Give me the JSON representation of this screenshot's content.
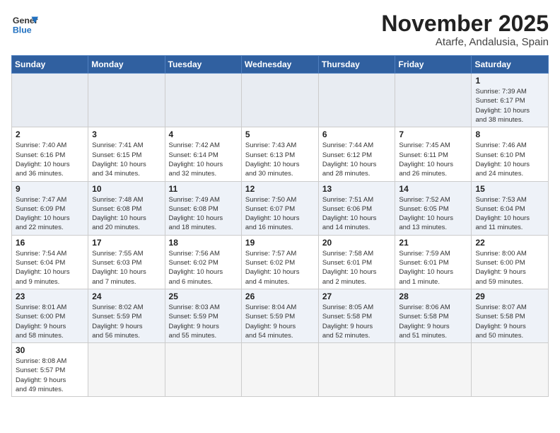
{
  "header": {
    "logo_general": "General",
    "logo_blue": "Blue",
    "month_year": "November 2025",
    "location": "Atarfe, Andalusia, Spain"
  },
  "weekdays": [
    "Sunday",
    "Monday",
    "Tuesday",
    "Wednesday",
    "Thursday",
    "Friday",
    "Saturday"
  ],
  "weeks": [
    [
      {
        "day": "",
        "info": ""
      },
      {
        "day": "",
        "info": ""
      },
      {
        "day": "",
        "info": ""
      },
      {
        "day": "",
        "info": ""
      },
      {
        "day": "",
        "info": ""
      },
      {
        "day": "",
        "info": ""
      },
      {
        "day": "1",
        "info": "Sunrise: 7:39 AM\nSunset: 6:17 PM\nDaylight: 10 hours\nand 38 minutes."
      }
    ],
    [
      {
        "day": "2",
        "info": "Sunrise: 7:40 AM\nSunset: 6:16 PM\nDaylight: 10 hours\nand 36 minutes."
      },
      {
        "day": "3",
        "info": "Sunrise: 7:41 AM\nSunset: 6:15 PM\nDaylight: 10 hours\nand 34 minutes."
      },
      {
        "day": "4",
        "info": "Sunrise: 7:42 AM\nSunset: 6:14 PM\nDaylight: 10 hours\nand 32 minutes."
      },
      {
        "day": "5",
        "info": "Sunrise: 7:43 AM\nSunset: 6:13 PM\nDaylight: 10 hours\nand 30 minutes."
      },
      {
        "day": "6",
        "info": "Sunrise: 7:44 AM\nSunset: 6:12 PM\nDaylight: 10 hours\nand 28 minutes."
      },
      {
        "day": "7",
        "info": "Sunrise: 7:45 AM\nSunset: 6:11 PM\nDaylight: 10 hours\nand 26 minutes."
      },
      {
        "day": "8",
        "info": "Sunrise: 7:46 AM\nSunset: 6:10 PM\nDaylight: 10 hours\nand 24 minutes."
      }
    ],
    [
      {
        "day": "9",
        "info": "Sunrise: 7:47 AM\nSunset: 6:09 PM\nDaylight: 10 hours\nand 22 minutes."
      },
      {
        "day": "10",
        "info": "Sunrise: 7:48 AM\nSunset: 6:08 PM\nDaylight: 10 hours\nand 20 minutes."
      },
      {
        "day": "11",
        "info": "Sunrise: 7:49 AM\nSunset: 6:08 PM\nDaylight: 10 hours\nand 18 minutes."
      },
      {
        "day": "12",
        "info": "Sunrise: 7:50 AM\nSunset: 6:07 PM\nDaylight: 10 hours\nand 16 minutes."
      },
      {
        "day": "13",
        "info": "Sunrise: 7:51 AM\nSunset: 6:06 PM\nDaylight: 10 hours\nand 14 minutes."
      },
      {
        "day": "14",
        "info": "Sunrise: 7:52 AM\nSunset: 6:05 PM\nDaylight: 10 hours\nand 13 minutes."
      },
      {
        "day": "15",
        "info": "Sunrise: 7:53 AM\nSunset: 6:04 PM\nDaylight: 10 hours\nand 11 minutes."
      }
    ],
    [
      {
        "day": "16",
        "info": "Sunrise: 7:54 AM\nSunset: 6:04 PM\nDaylight: 10 hours\nand 9 minutes."
      },
      {
        "day": "17",
        "info": "Sunrise: 7:55 AM\nSunset: 6:03 PM\nDaylight: 10 hours\nand 7 minutes."
      },
      {
        "day": "18",
        "info": "Sunrise: 7:56 AM\nSunset: 6:02 PM\nDaylight: 10 hours\nand 6 minutes."
      },
      {
        "day": "19",
        "info": "Sunrise: 7:57 AM\nSunset: 6:02 PM\nDaylight: 10 hours\nand 4 minutes."
      },
      {
        "day": "20",
        "info": "Sunrise: 7:58 AM\nSunset: 6:01 PM\nDaylight: 10 hours\nand 2 minutes."
      },
      {
        "day": "21",
        "info": "Sunrise: 7:59 AM\nSunset: 6:01 PM\nDaylight: 10 hours\nand 1 minute."
      },
      {
        "day": "22",
        "info": "Sunrise: 8:00 AM\nSunset: 6:00 PM\nDaylight: 9 hours\nand 59 minutes."
      }
    ],
    [
      {
        "day": "23",
        "info": "Sunrise: 8:01 AM\nSunset: 6:00 PM\nDaylight: 9 hours\nand 58 minutes."
      },
      {
        "day": "24",
        "info": "Sunrise: 8:02 AM\nSunset: 5:59 PM\nDaylight: 9 hours\nand 56 minutes."
      },
      {
        "day": "25",
        "info": "Sunrise: 8:03 AM\nSunset: 5:59 PM\nDaylight: 9 hours\nand 55 minutes."
      },
      {
        "day": "26",
        "info": "Sunrise: 8:04 AM\nSunset: 5:59 PM\nDaylight: 9 hours\nand 54 minutes."
      },
      {
        "day": "27",
        "info": "Sunrise: 8:05 AM\nSunset: 5:58 PM\nDaylight: 9 hours\nand 52 minutes."
      },
      {
        "day": "28",
        "info": "Sunrise: 8:06 AM\nSunset: 5:58 PM\nDaylight: 9 hours\nand 51 minutes."
      },
      {
        "day": "29",
        "info": "Sunrise: 8:07 AM\nSunset: 5:58 PM\nDaylight: 9 hours\nand 50 minutes."
      }
    ],
    [
      {
        "day": "30",
        "info": "Sunrise: 8:08 AM\nSunset: 5:57 PM\nDaylight: 9 hours\nand 49 minutes."
      },
      {
        "day": "",
        "info": ""
      },
      {
        "day": "",
        "info": ""
      },
      {
        "day": "",
        "info": ""
      },
      {
        "day": "",
        "info": ""
      },
      {
        "day": "",
        "info": ""
      },
      {
        "day": "",
        "info": ""
      }
    ]
  ]
}
